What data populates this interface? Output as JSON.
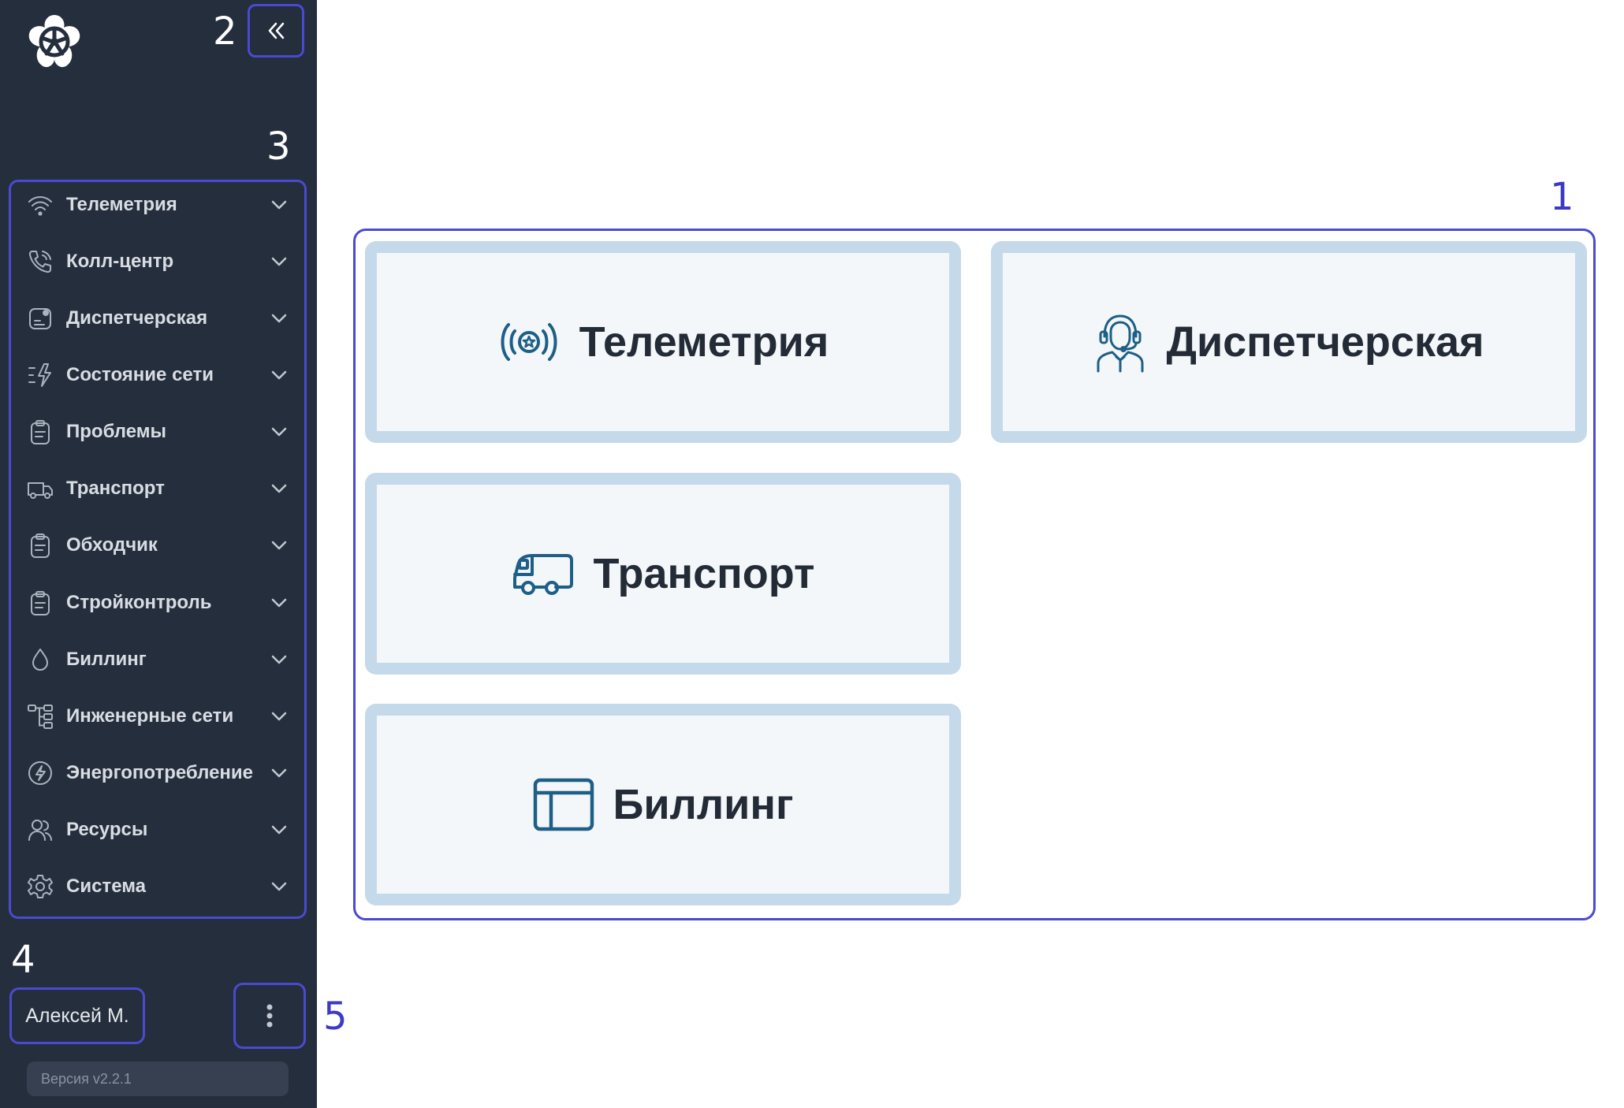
{
  "sidebar": {
    "logo_icon": "flower-logo-icon",
    "collapse_icon": "double-chevron-left-icon",
    "items": [
      {
        "label": "Телеметрия",
        "icon": "wifi-icon"
      },
      {
        "label": "Колл-центр",
        "icon": "phone-icon"
      },
      {
        "label": "Диспетчерская",
        "icon": "dispatch-icon"
      },
      {
        "label": "Состояние сети",
        "icon": "network-state-icon"
      },
      {
        "label": "Проблемы",
        "icon": "clipboard-icon"
      },
      {
        "label": "Транспорт",
        "icon": "truck-icon"
      },
      {
        "label": "Обходчик",
        "icon": "clipboard-icon"
      },
      {
        "label": "Стройконтроль",
        "icon": "clipboard-icon"
      },
      {
        "label": "Биллинг",
        "icon": "drop-icon"
      },
      {
        "label": "Инженерные сети",
        "icon": "tree-icon"
      },
      {
        "label": "Энергопотребление",
        "icon": "energy-icon"
      },
      {
        "label": "Ресурсы",
        "icon": "users-icon"
      },
      {
        "label": "Система",
        "icon": "gear-icon"
      }
    ],
    "user_name": "Алексей М.",
    "more_icon": "kebab-menu-icon",
    "version": "Версия v2.2.1"
  },
  "annotations": {
    "m1": "1",
    "m2": "2",
    "m3": "3",
    "m4": "4",
    "m5": "5"
  },
  "cards": [
    {
      "label": "Телеметрия",
      "icon": "telemetry-signal-icon"
    },
    {
      "label": "Диспетчерская",
      "icon": "operator-headset-icon"
    },
    {
      "label": "Транспорт",
      "icon": "truck-icon"
    },
    {
      "label": "Биллинг",
      "icon": "billing-window-icon"
    }
  ],
  "colors": {
    "sidebar_bg": "#252e3d",
    "annotation_frame": "#4a4ad0",
    "card_border": "#c4d9ea",
    "card_icon": "#1d5f86"
  }
}
